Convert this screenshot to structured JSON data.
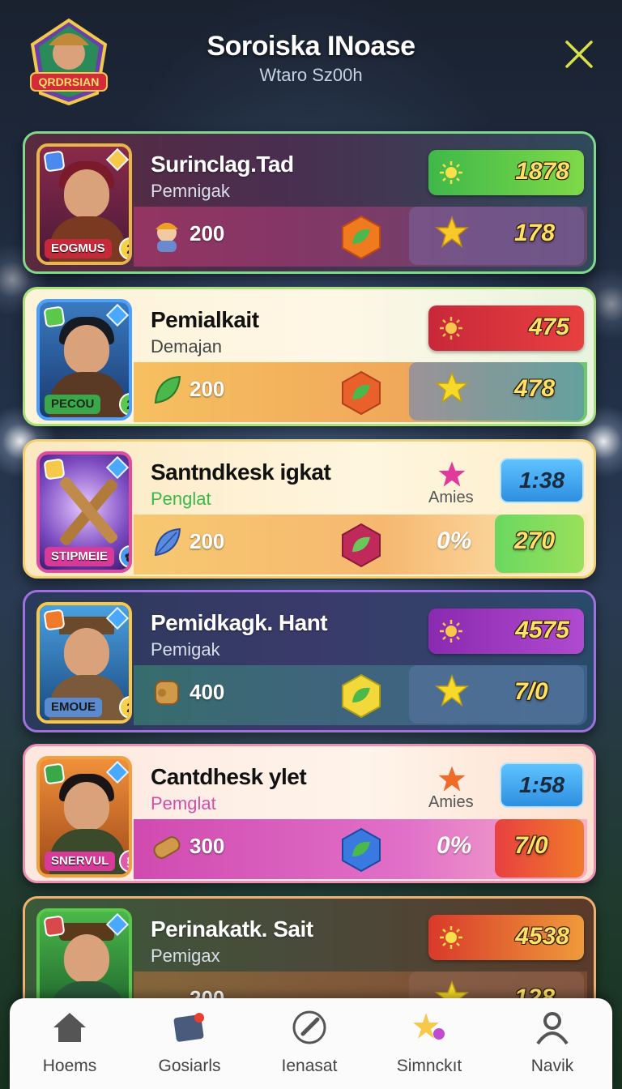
{
  "header": {
    "logo_text": "QRDRSIAN",
    "title": "Soroiska INoase",
    "subtitle": "Wtaro Sz00h"
  },
  "cards": [
    {
      "name": "Surinclag.Tad",
      "role": "Pemnigak",
      "banner": "EOGMUS",
      "level": "2",
      "resource_value": "200",
      "pill_value": "1878",
      "stat_value": "178"
    },
    {
      "name": "Pemialkait",
      "role": "Demajan",
      "banner": "PECOU",
      "level": "2",
      "resource_value": "200",
      "pill_value": "475",
      "stat_value": "478"
    },
    {
      "name": "Santndkesk igkat",
      "role": "Penglat",
      "banner": "STIPMEIE",
      "mid_label": "Amies",
      "resource_value": "200",
      "pill_value": "1:38",
      "pct_value": "0%",
      "stat_value": "270"
    },
    {
      "name": "Pemidkagk. Hant",
      "role": "Pemigak",
      "banner": "EMOUE",
      "level": "2",
      "resource_value": "400",
      "pill_value": "4575",
      "stat_value": "7/0"
    },
    {
      "name": "Cantdhesk ylet",
      "role": "Pemglat",
      "banner": "SNERVUL",
      "mid_label": "Amies",
      "resource_value": "300",
      "pill_value": "1:58",
      "pct_value": "0%",
      "stat_value": "7/0"
    },
    {
      "name": "Perinakatk. Sait",
      "role": "Pemigax",
      "resource_value": "200",
      "pill_value": "4538",
      "stat_value": "128"
    }
  ],
  "nav": {
    "items": [
      {
        "label": "Hoems",
        "icon": "home-icon"
      },
      {
        "label": "Gosiarls",
        "icon": "tablet-icon"
      },
      {
        "label": "Ienasat",
        "icon": "brush-icon"
      },
      {
        "label": "Simnckıt",
        "icon": "sparkle-icon"
      },
      {
        "label": "Navik",
        "icon": "user-icon"
      }
    ]
  },
  "colors": {
    "pill_green": "#5cc83a",
    "pill_red": "#d9323d",
    "pill_purple": "#a23cc0",
    "pill_orange": "#e8582a",
    "pill_blue": "#3fa8ef",
    "stat_yellow": "#ffe168"
  }
}
